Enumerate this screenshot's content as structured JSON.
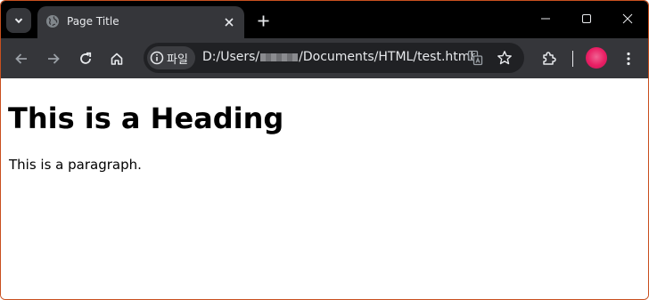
{
  "browser": {
    "tab": {
      "title": "Page Title"
    },
    "address_bar": {
      "chip_label": "파일",
      "url_prefix": "D:/Users/",
      "url_suffix": "/Documents/HTML/test.html"
    },
    "icons": {
      "tab_search": "chevron-down-icon",
      "favicon": "globe-icon",
      "tab_close": "close-icon",
      "new_tab": "plus-icon",
      "back": "arrow-left-icon",
      "forward": "arrow-right-icon",
      "reload": "reload-icon",
      "home": "home-icon",
      "site_info": "info-icon",
      "translate": "translate-icon",
      "bookmark": "star-icon",
      "extensions": "puzzle-icon",
      "menu": "more-vertical-icon",
      "minimize": "minimize-icon",
      "maximize": "maximize-icon",
      "close_window": "close-icon"
    },
    "colors": {
      "tab_strip": "#000000",
      "toolbar": "#35363a",
      "omnibox": "#202124",
      "window_border": "#c9501f",
      "avatar": "#e91e63"
    }
  },
  "page": {
    "heading": "This is a Heading",
    "paragraph": "This is a paragraph."
  }
}
